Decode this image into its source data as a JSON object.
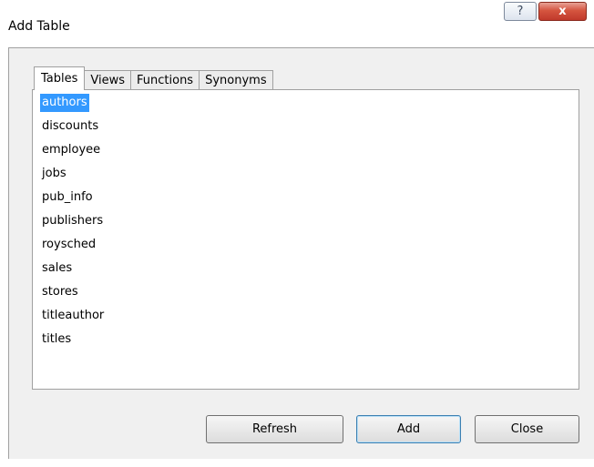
{
  "window": {
    "title": "Add Table",
    "help_glyph": "?",
    "close_glyph": "x"
  },
  "tabs": [
    {
      "label": "Tables",
      "active": true
    },
    {
      "label": "Views",
      "active": false
    },
    {
      "label": "Functions",
      "active": false
    },
    {
      "label": "Synonyms",
      "active": false
    }
  ],
  "list": {
    "selected": "authors",
    "items": [
      "authors",
      "discounts",
      "employee",
      "jobs",
      "pub_info",
      "publishers",
      "roysched",
      "sales",
      "stores",
      "titleauthor",
      "titles"
    ]
  },
  "buttons": {
    "refresh": "Refresh",
    "add": "Add",
    "close": "Close"
  },
  "colors": {
    "selection": "#3399ff",
    "dialog_bg": "#f0f0f0",
    "close_button": "#c0392b"
  },
  "icons": {
    "help": "help-icon",
    "close": "close-icon"
  }
}
